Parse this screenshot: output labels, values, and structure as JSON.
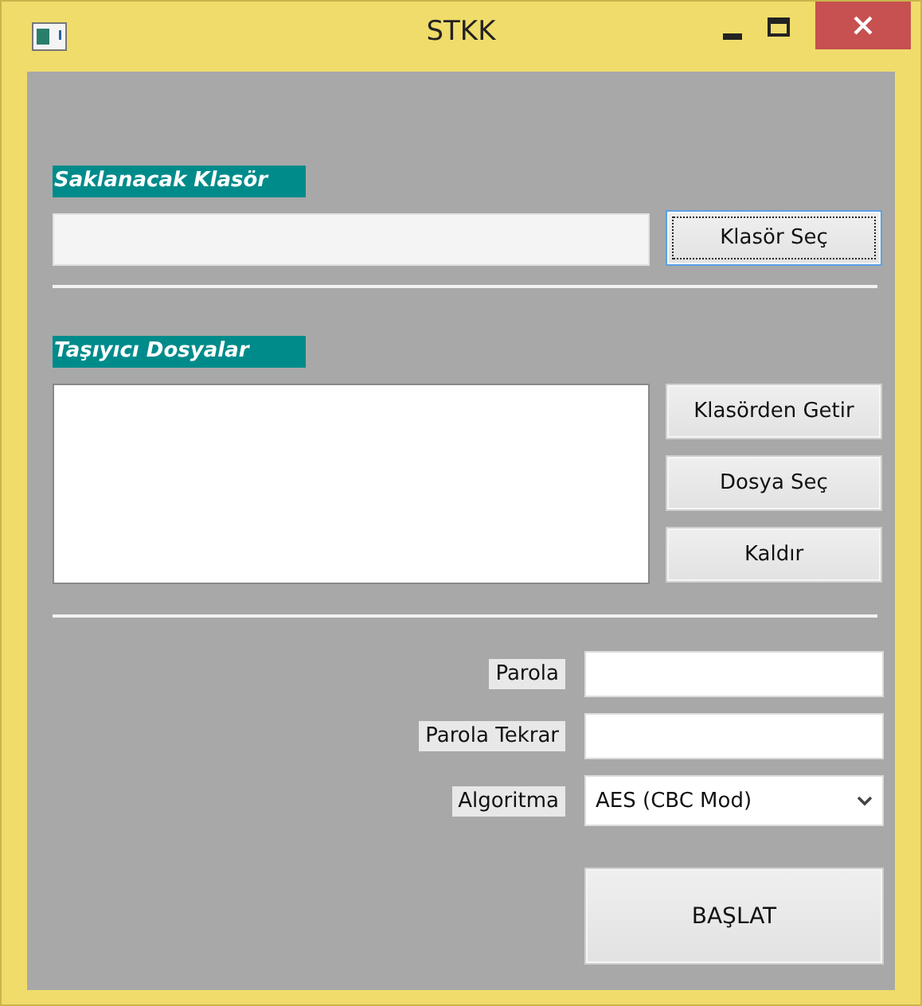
{
  "window": {
    "title": "STKK"
  },
  "folder_section": {
    "heading": "Saklanacak Klasör",
    "button": {
      "label": "Klasör Seç",
      "focused": true
    }
  },
  "carrier_section": {
    "heading": "Taşıyıcı Dosyalar",
    "buttons": [
      "Klasörden Getir",
      "Dosya Seç",
      "Kaldır"
    ]
  },
  "form": [
    {
      "kind": "text",
      "label": "Parola"
    },
    {
      "kind": "text",
      "label": "Parola Tekrar"
    },
    {
      "kind": "select",
      "label": "Algoritma",
      "value": "AES (CBC Mod)"
    }
  ],
  "start_button": {
    "label": "BAŞLAT"
  }
}
